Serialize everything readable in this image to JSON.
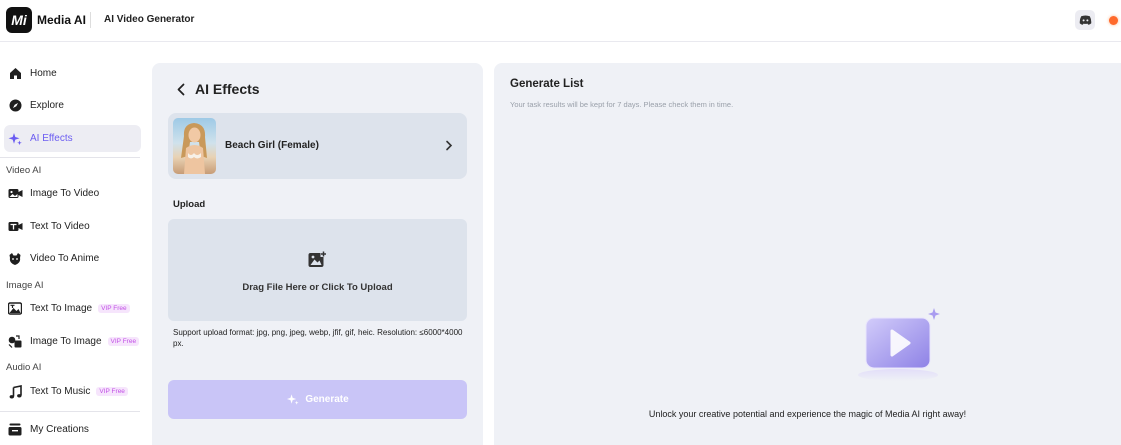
{
  "header": {
    "brand": "Media AI",
    "logo_text": "Mi",
    "page_title": "AI Video Generator"
  },
  "sidebar": {
    "items": [
      {
        "label": "Home",
        "icon": "home-icon"
      },
      {
        "label": "Explore",
        "icon": "compass-icon"
      },
      {
        "label": "AI Effects",
        "icon": "sparkle-icon",
        "active": true
      }
    ],
    "video_section": "Video AI",
    "video_items": [
      {
        "label": "Image To Video",
        "icon": "image-video-icon"
      },
      {
        "label": "Text To Video",
        "icon": "text-video-icon"
      },
      {
        "label": "Video To Anime",
        "icon": "anime-icon"
      }
    ],
    "image_section": "Image AI",
    "image_items": [
      {
        "label": "Text To Image",
        "icon": "text-image-icon",
        "badge": "VIP Free"
      },
      {
        "label": "Image To Image",
        "icon": "image-image-icon",
        "badge": "VIP Free"
      }
    ],
    "audio_section": "Audio AI",
    "audio_items": [
      {
        "label": "Text To Music",
        "icon": "music-icon",
        "badge": "VIP Free"
      }
    ],
    "my_creations": "My Creations"
  },
  "effects_panel": {
    "title": "AI Effects",
    "effect_name": "Beach Girl (Female)",
    "upload_label": "Upload",
    "drop_text": "Drag File Here or Click To Upload",
    "support_text": "Support upload format: jpg, png, jpeg, webp, jfif, gif, heic. Resolution: ≤6000*4000 px.",
    "generate_label": "Generate"
  },
  "generate_list": {
    "title": "Generate List",
    "subtitle": "Your task results will be kept for 7 days. Please check them in time.",
    "empty_text": "Unlock your creative potential and experience the magic of Media AI right away!"
  },
  "colors": {
    "accent": "#6b5cf2",
    "generate_button": "#c9c5f7",
    "badge": "#c24fe6",
    "panel_bg": "#eff1f6"
  }
}
